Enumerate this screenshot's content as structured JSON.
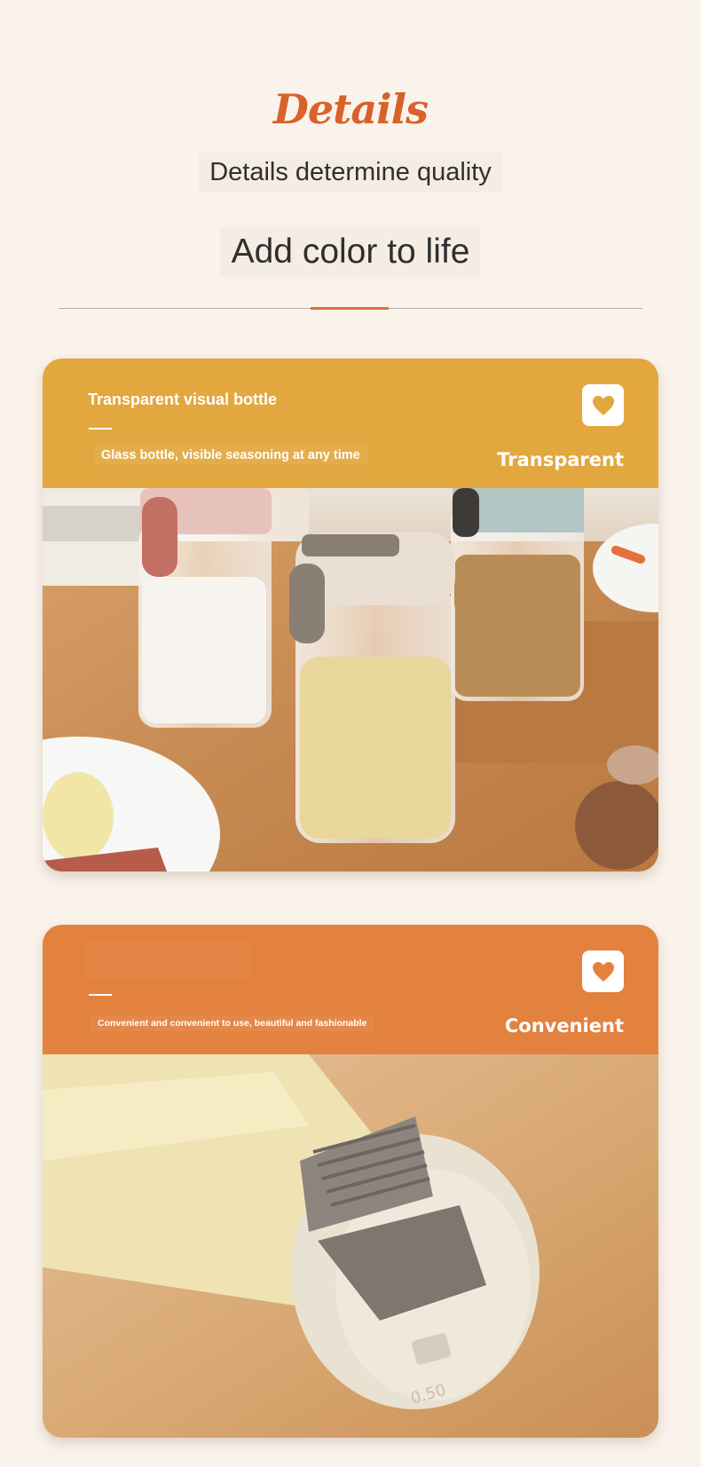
{
  "header": {
    "script_title": "Details",
    "subtitle": "Details determine quality",
    "tagline": "Add color to life"
  },
  "colors": {
    "background": "#faf3ec",
    "title_accent": "#d9612a",
    "band_yellow": "#e3a73f",
    "band_orange": "#e3813f"
  },
  "cards": [
    {
      "title": "Transparent visual bottle",
      "description": "Glass bottle, visible seasoning at any time",
      "keyword": "Transparent",
      "icon": "heart-icon",
      "photo": "three seasoning bottles on wooden table"
    },
    {
      "title": "",
      "description": "Convenient and convenient to use, beautiful and fashionable",
      "keyword": "Convenient",
      "icon": "heart-icon",
      "photo": "close-up of bottle dispenser cap with lever"
    }
  ],
  "photo_embossed_text": "0.50"
}
